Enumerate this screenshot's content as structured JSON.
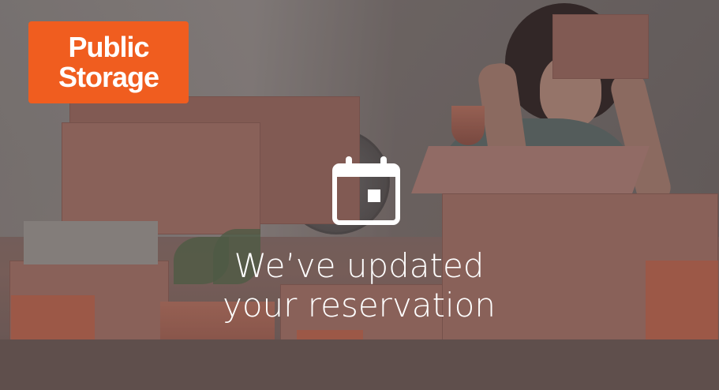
{
  "brand": {
    "line1": "Public",
    "line2": "Storage",
    "color": "#f05d1f"
  },
  "icon": "calendar-icon",
  "message": {
    "line1": "We’ve updated",
    "line2": "your reservation"
  },
  "colors": {
    "text": "#ffffff",
    "box": "#a7756a"
  }
}
